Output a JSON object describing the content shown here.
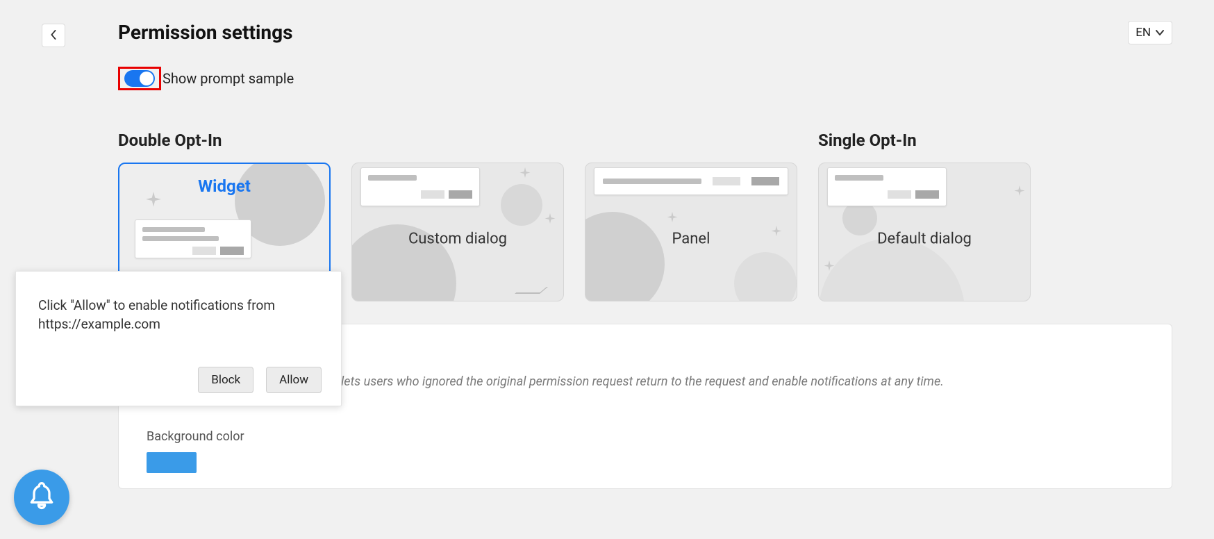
{
  "header": {
    "page_title": "Permission settings",
    "language": "EN"
  },
  "toggle": {
    "label": "Show prompt sample",
    "on": true
  },
  "sections": {
    "double_opt_in": "Double Opt-In",
    "single_opt_in": "Single Opt-In"
  },
  "cards": {
    "widget": "Widget",
    "custom_dialog": "Custom dialog",
    "panel": "Panel",
    "default_dialog": "Default dialog"
  },
  "detail": {
    "description_suffix": "until the user allows notifications. It lets users who ignored the original permission request return to the request and enable notifications at any time.",
    "background_color_label": "Background color",
    "background_color": "#3a9be8"
  },
  "prompt": {
    "message": "Click \"Allow\" to enable notifications from https://example.com",
    "block": "Block",
    "allow": "Allow"
  },
  "icons": {
    "back": "chevron-left",
    "lang_chevron": "chevron-down",
    "bell": "bell"
  },
  "colors": {
    "accent": "#1976f0",
    "highlight_box": "#e80000",
    "fab": "#3a9be8"
  }
}
